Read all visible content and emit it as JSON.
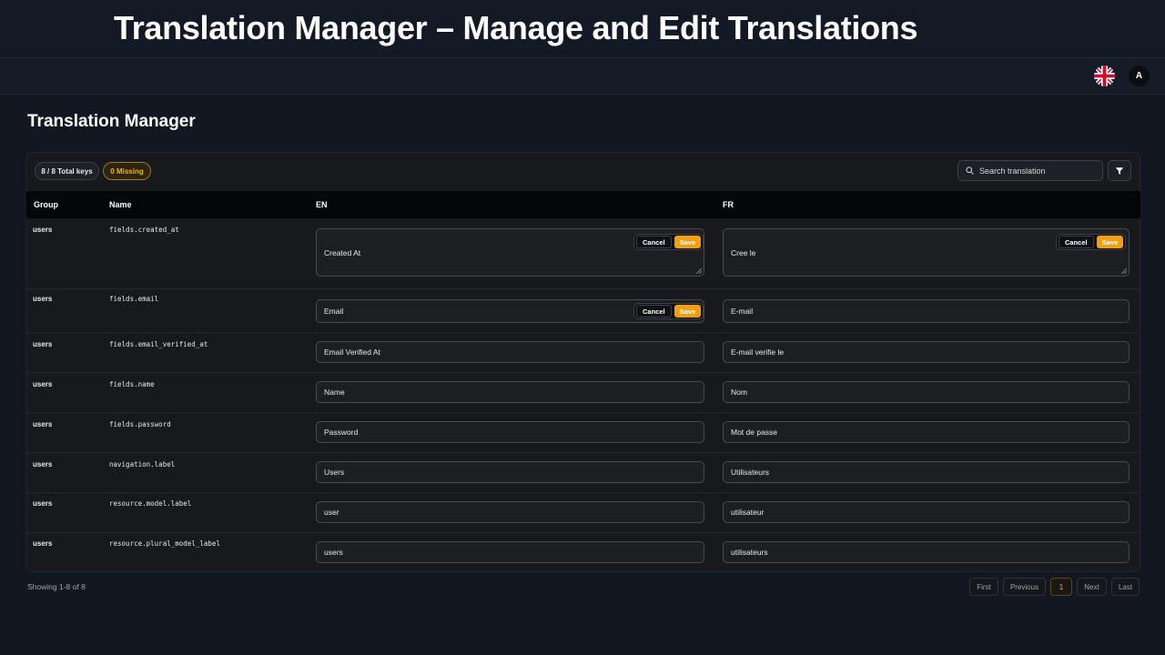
{
  "banner": {
    "title": "Translation Manager – Manage and Edit Translations"
  },
  "topbar": {
    "avatar_initial": "A"
  },
  "page": {
    "title": "Translation Manager"
  },
  "badges": {
    "total": "8 / 8 Total keys",
    "missing": "0 Missing"
  },
  "search": {
    "placeholder": "Search translation"
  },
  "table": {
    "headers": {
      "group": "Group",
      "name": "Name",
      "en": "EN",
      "fr": "FR"
    },
    "rows": [
      {
        "group": "users",
        "name": "fields.created_at",
        "en": "Created At",
        "fr": "Cree le"
      },
      {
        "group": "users",
        "name": "fields.email",
        "en": "Email",
        "fr": "E-mail"
      },
      {
        "group": "users",
        "name": "fields.email_verified_at",
        "en": "Email Verified At",
        "fr": "E-mail verifie le"
      },
      {
        "group": "users",
        "name": "fields.name",
        "en": "Name",
        "fr": "Nom"
      },
      {
        "group": "users",
        "name": "fields.password",
        "en": "Password",
        "fr": "Mot de passe"
      },
      {
        "group": "users",
        "name": "navigation.label",
        "en": "Users",
        "fr": "Utilisateurs"
      },
      {
        "group": "users",
        "name": "resource.model.label",
        "en": "user",
        "fr": "utilisateur"
      },
      {
        "group": "users",
        "name": "resource.plural_model_label",
        "en": "users",
        "fr": "utilisateurs"
      }
    ]
  },
  "actions": {
    "cancel": "Cancel",
    "save": "Save"
  },
  "footer": {
    "showing": "Showing 1-8 of 8"
  },
  "pagination": {
    "first": "First",
    "previous": "Previous",
    "current": "1",
    "next": "Next",
    "last": "Last"
  },
  "colors": {
    "accent": "#f59e0b",
    "background": "#121722",
    "card": "#17191d"
  }
}
